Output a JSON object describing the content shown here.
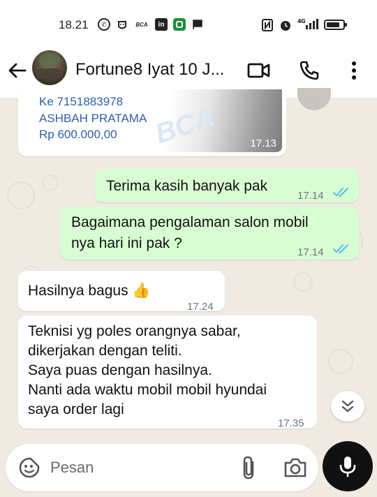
{
  "status_bar": {
    "time": "18.21",
    "left_icons": [
      "whatsapp-icon",
      "bug-icon",
      "bca-icon",
      "linkedin-icon",
      "shield-app-icon",
      "flag-icon"
    ],
    "right_icons": [
      "nfc-icon",
      "alarm-icon",
      "network-4g-icon",
      "battery-icon"
    ],
    "bca_text": "BCA",
    "network_text": "⁴ᴳ"
  },
  "header": {
    "title": "Fortune8 Iyat 10 J...",
    "icons": [
      "back-arrow-icon",
      "video-call-icon",
      "phone-call-icon",
      "more-options-icon"
    ]
  },
  "messages": [
    {
      "type": "image",
      "direction": "in",
      "lines": [
        "Ke 7151883978",
        "ASHBAH PRATAMA",
        "Rp 600.000,00"
      ],
      "watermark": "BCA",
      "time": "17.13"
    },
    {
      "type": "text",
      "direction": "out",
      "lines": [
        "Terima kasih banyak pak"
      ],
      "time": "17.14",
      "status": "read"
    },
    {
      "type": "text",
      "direction": "out",
      "lines": [
        "Bagaimana pengalaman salon mobil",
        "nya hari ini pak ?"
      ],
      "time": "17.14",
      "status": "read"
    },
    {
      "type": "text",
      "direction": "in",
      "lines": [
        "Hasilnya bagus 👍"
      ],
      "time": "17.24"
    },
    {
      "type": "text",
      "direction": "in",
      "lines": [
        "Teknisi yg poles orangnya sabar,",
        "dikerjakan dengan teliti.",
        "Saya puas dengan hasilnya.",
        "Nanti ada waktu mobil mobil hyundai",
        "saya order lagi"
      ],
      "time": "17.35"
    }
  ],
  "composer": {
    "placeholder": "Pesan",
    "icons": [
      "emoji-icon",
      "attach-icon",
      "camera-icon",
      "mic-icon"
    ]
  },
  "scroll_down_icon": "double-chevron-down-icon",
  "colors": {
    "outgoing_bubble": "#d9fdd3",
    "incoming_bubble": "#ffffff",
    "wallpaper": "#efeae2",
    "read_ticks": "#53bdeb",
    "mic_button": "#111111"
  }
}
